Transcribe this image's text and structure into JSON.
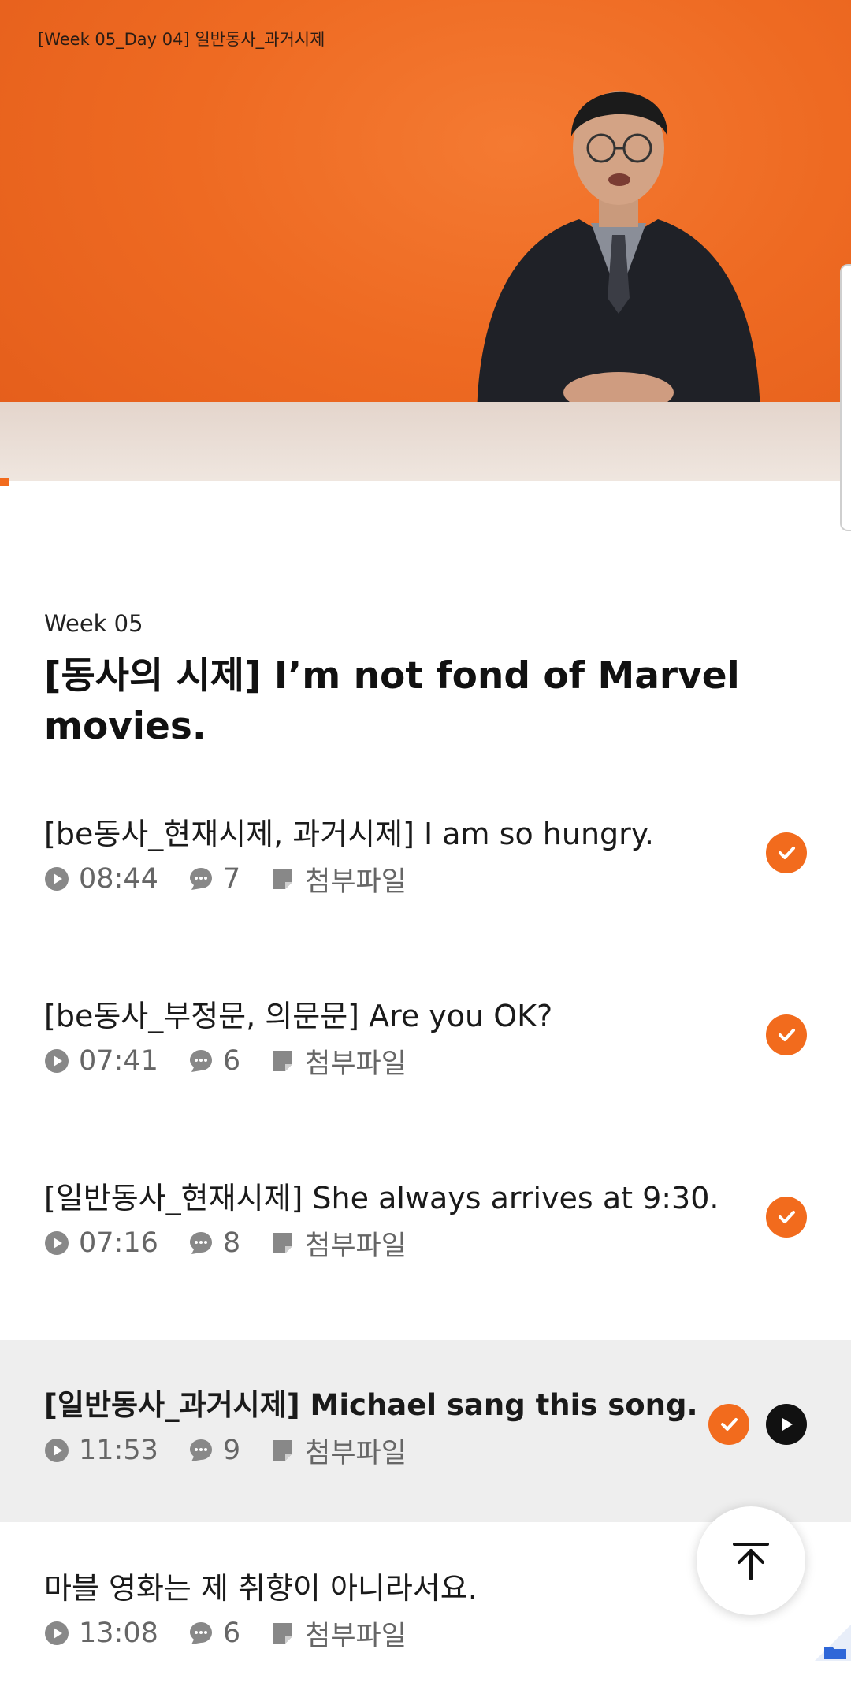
{
  "video": {
    "title": "[Week 05_Day 04] 일반동사_과거시제",
    "progress_fraction": 0.01
  },
  "section": {
    "week_label": "Week 05",
    "title": "[동사의 시제] I’m not fond of Marvel movies."
  },
  "lessons": [
    {
      "title": "[be동사_현재시제, 과거시제] I am so hungry.",
      "duration": "08:44",
      "comments": "7",
      "attachment": "첨부파일",
      "completed": true,
      "active": false
    },
    {
      "title": "[be동사_부정문, 의문문] Are you OK?",
      "duration": "07:41",
      "comments": "6",
      "attachment": "첨부파일",
      "completed": true,
      "active": false
    },
    {
      "title": "[일반동사_현재시제] She always arrives at 9:30.",
      "duration": "07:16",
      "comments": "8",
      "attachment": "첨부파일",
      "completed": true,
      "active": false
    },
    {
      "title": "[일반동사_과거시제] Michael sang this song.",
      "duration": "11:53",
      "comments": "9",
      "attachment": "첨부파일",
      "completed": true,
      "active": true
    },
    {
      "title": "마블 영화는 제 취향이 아니라서요.",
      "duration": "13:08",
      "comments": "6",
      "attachment": "첨부파일",
      "completed": false,
      "active": false
    }
  ],
  "colors": {
    "accent": "#f26b1d",
    "active_row_bg": "#eeeeee",
    "meta_gray": "#666666"
  },
  "icons": {
    "duration": "play-circle-icon",
    "comments": "comment-bubble-icon",
    "attachment": "note-icon",
    "completed": "check-circle-icon",
    "now_playing": "play-button-icon",
    "scroll_top": "arrow-up-icon"
  }
}
